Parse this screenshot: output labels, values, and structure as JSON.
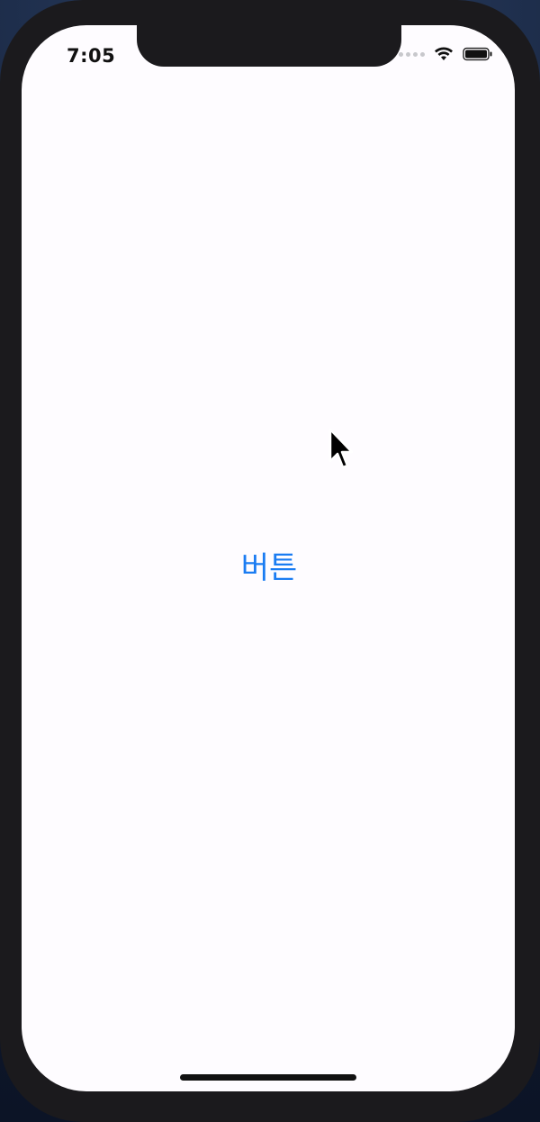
{
  "status_bar": {
    "time": "7:05",
    "icons": [
      "cellular-signal-icon",
      "wifi-icon",
      "battery-icon"
    ]
  },
  "main": {
    "button_label": "버튼"
  },
  "colors": {
    "accent": "#1a7cf2",
    "screen_background": "#fefcff",
    "device_frame": "#1b1a1d"
  }
}
